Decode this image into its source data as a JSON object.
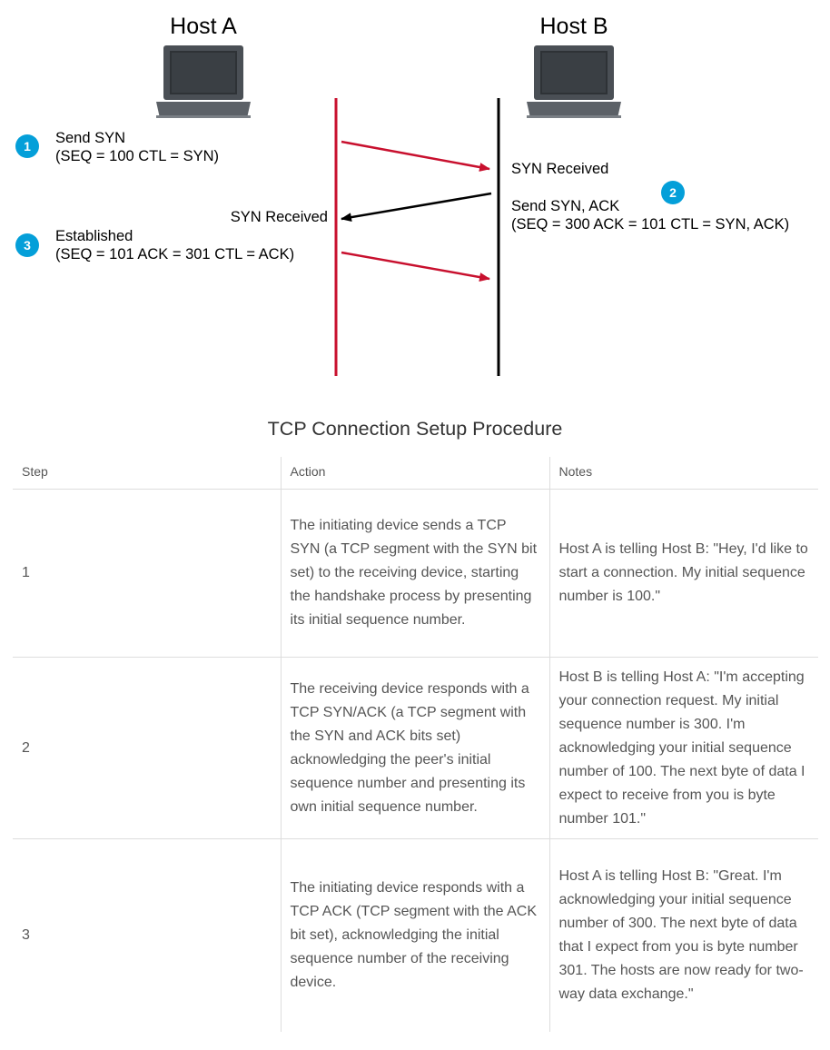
{
  "diagram": {
    "host_a": "Host A",
    "host_b": "Host B",
    "step1": {
      "badge": "1",
      "line1": "Send SYN",
      "line2": "(SEQ = 100 CTL = SYN)"
    },
    "step2": {
      "badge": "2",
      "received": "SYN Received",
      "line1": "Send SYN, ACK",
      "line2": "(SEQ = 300 ACK = 101 CTL = SYN, ACK)"
    },
    "step3": {
      "badge": "3",
      "received": "SYN Received",
      "line1": "Established",
      "line2": "(SEQ = 101 ACK = 301 CTL = ACK)"
    },
    "colors": {
      "host_a_line": "#c8102e",
      "host_b_line": "#000000",
      "badge": "#049fd9",
      "laptop": "#4a4f55"
    }
  },
  "caption": "TCP Connection Setup Procedure",
  "table": {
    "headers": [
      "Step",
      "Action",
      "Notes"
    ],
    "rows": [
      {
        "step": "1",
        "action": "The initiating device sends a TCP SYN (a TCP segment with the SYN bit set) to the receiving device, starting the handshake process by presenting its initial sequence number.",
        "notes": "Host A is telling Host B: \"Hey, I'd like to start a connection. My initial sequence number is 100.\""
      },
      {
        "step": "2",
        "action": "The receiving device responds with a TCP SYN/ACK (a TCP segment with the SYN and ACK bits set) acknowledging the peer's initial sequence number and presenting its own initial sequence number.",
        "notes": "Host B is telling Host A: \"I'm accepting your connection request. My initial sequence number is 300. I'm acknowledging your initial sequence number of 100. The next byte of data I expect to receive from you is byte number 101.\""
      },
      {
        "step": "3",
        "action": "The initiating device responds with a TCP ACK (TCP segment with the ACK bit set), acknowledging the initial sequence number of the receiving device.",
        "notes": "Host A is telling Host B: \"Great. I'm acknowledging your initial sequence number of 300. The next byte of data that I expect from you is byte number 301. The hosts are now ready for two-way data exchange.\""
      }
    ]
  }
}
